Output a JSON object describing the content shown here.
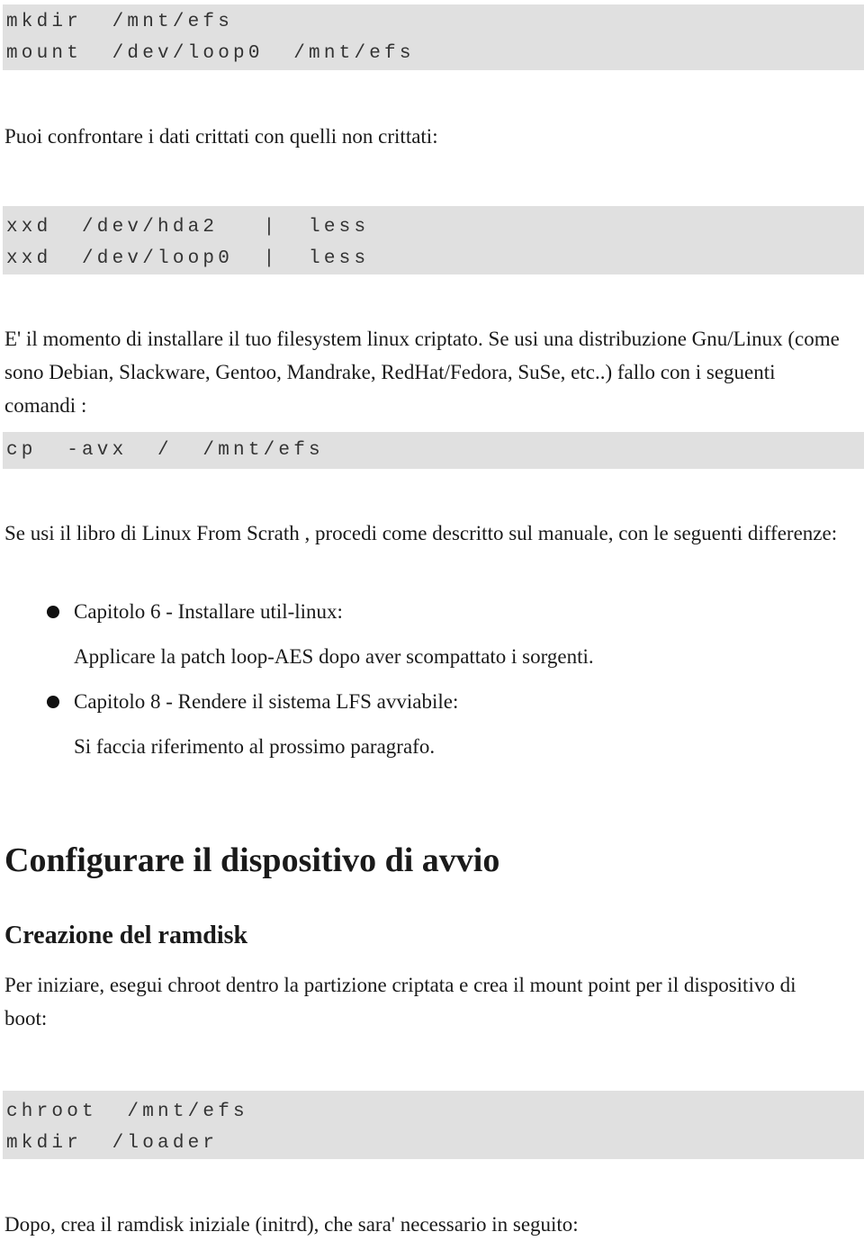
{
  "code_blocks": [
    {
      "lines": [
        "mkdir  /mnt/efs",
        "mount  /dev/loop0  /mnt/efs"
      ]
    },
    {
      "lines": [
        "xxd  /dev/hda2   |  less",
        "xxd  /dev/loop0  |  less"
      ]
    },
    {
      "lines": [
        "cp  -avx  /  /mnt/efs"
      ]
    },
    {
      "lines": [
        "chroot  /mnt/efs",
        "mkdir  /loader"
      ]
    }
  ],
  "paragraphs": {
    "compare": "Puoi confrontare i dati crittati con quelli non crittati:",
    "install": "E' il momento di installare il tuo filesystem linux criptato. Se usi una distribuzione Gnu/Linux (come sono Debian, Slackware, Gentoo, Mandrake, RedHat/Fedora, SuSe, etc..) fallo con i seguenti comandi :",
    "lfs": "Se usi il libro di Linux From Scrath , procedi come descritto sul manuale, con le seguenti differenze:",
    "chroot": "Per iniziare, esegui chroot dentro la partizione criptata e crea il mount point per il dispositivo di boot:",
    "initrd": "Dopo, crea il ramdisk iniziale (initrd), che sara' necessario in seguito:"
  },
  "list": [
    {
      "title": "Capitolo 6 - Installare util-linux:",
      "detail": "Applicare la patch loop-AES dopo aver scompattato i sorgenti."
    },
    {
      "title": "Capitolo 8 - Rendere il sistema LFS avviabile:",
      "detail": "Si faccia riferimento al prossimo paragrafo."
    }
  ],
  "headings": {
    "section": "Configurare il dispositivo di avvio",
    "subsection": "Creazione del ramdisk"
  }
}
